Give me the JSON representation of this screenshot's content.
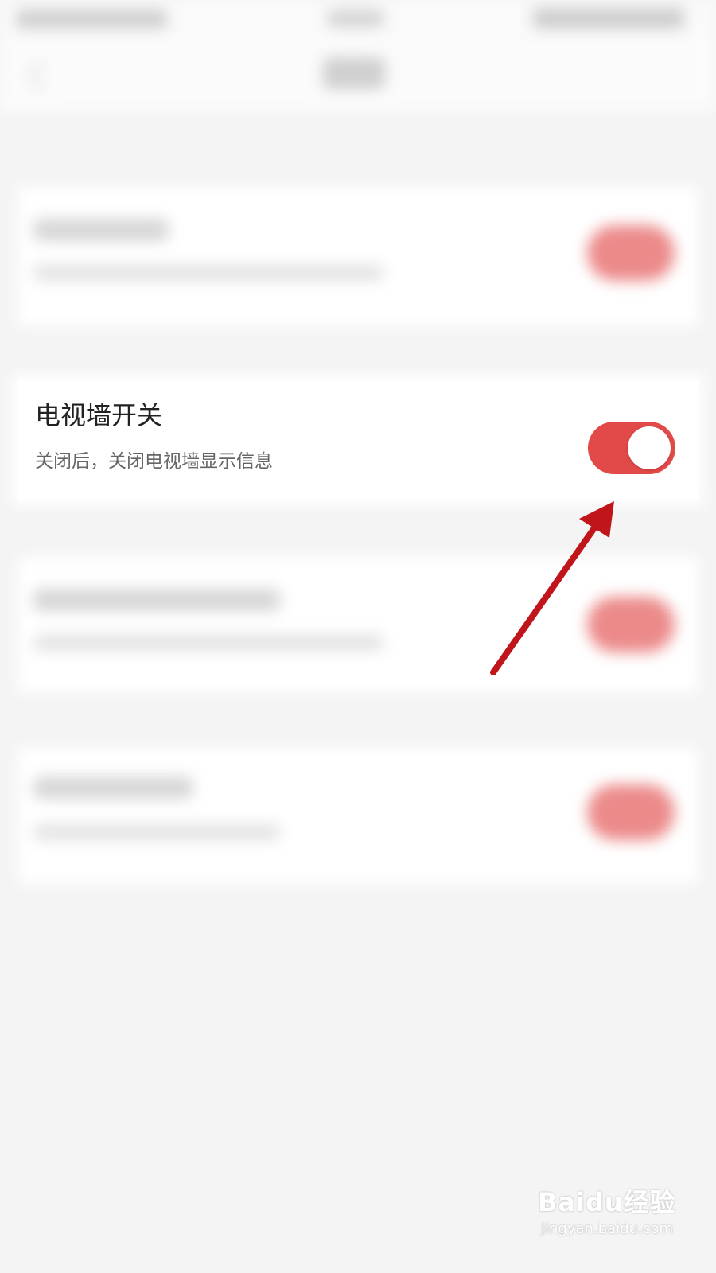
{
  "setting": {
    "title": "电视墙开关",
    "description": "关闭后，关闭电视墙显示信息",
    "toggle_on": true
  },
  "colors": {
    "accent": "#e24949",
    "arrow": "#c0151b",
    "page_bg": "#f4f4f4"
  },
  "watermark": {
    "brand": "Baidu经验",
    "url": "jingyan.baidu.com"
  }
}
